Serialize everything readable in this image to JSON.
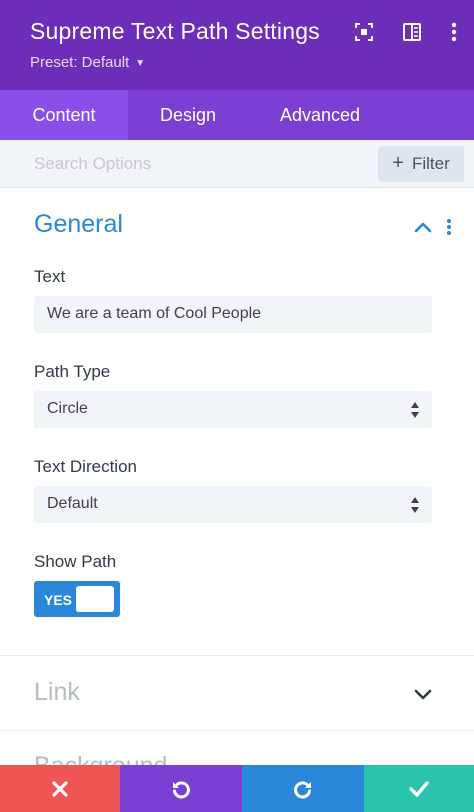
{
  "header": {
    "title": "Supreme Text Path Settings",
    "preset": "Preset: Default",
    "icons": [
      "expand-icon",
      "sidebar-layout-icon",
      "kebab-menu-icon"
    ]
  },
  "tabs": [
    {
      "label": "Content",
      "active": true
    },
    {
      "label": "Design",
      "active": false
    },
    {
      "label": "Advanced",
      "active": false
    }
  ],
  "search": {
    "placeholder": "Search Options",
    "filter_label": "Filter"
  },
  "general": {
    "title": "General",
    "text_label": "Text",
    "text_value": "We are a team of Cool People",
    "path_type_label": "Path Type",
    "path_type_value": "Circle",
    "direction_label": "Text Direction",
    "direction_value": "Default",
    "show_path_label": "Show Path",
    "show_path_value": "YES"
  },
  "sections": {
    "link": "Link",
    "background": "Background"
  },
  "footer": {
    "buttons": [
      "close",
      "undo",
      "redo",
      "save"
    ]
  },
  "colors": {
    "header": "#6c2eb9",
    "tab_bar": "#7b3fd3",
    "active_tab": "#8a4fe8",
    "accent_blue": "#2b87da",
    "close": "#ef5555",
    "undo": "#7b3fd3",
    "redo": "#2b87da",
    "save": "#29c4a9"
  }
}
